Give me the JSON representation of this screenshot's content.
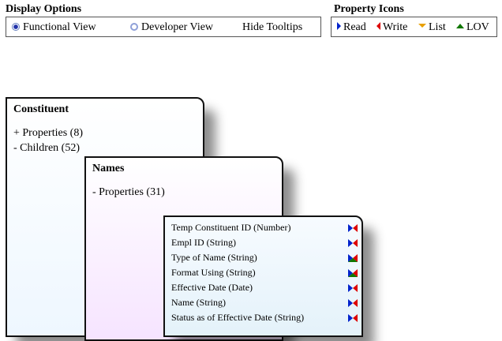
{
  "display_options": {
    "title": "Display Options",
    "functional_view": "Functional View",
    "developer_view": "Developer View",
    "hide_tooltips": "Hide Tooltips",
    "selected": "Functional View"
  },
  "property_icons": {
    "title": "Property Icons",
    "read": "Read",
    "write": "Write",
    "list": "List",
    "lov": "LOV",
    "colors": {
      "read": "#0022cc",
      "write": "#dd0000",
      "list": "#e8a000",
      "lov": "#117700"
    }
  },
  "cards": {
    "constituent": {
      "title": "Constituent",
      "properties": "+ Properties (8)",
      "children": "- Children (52)"
    },
    "names": {
      "title": "Names",
      "properties": "- Properties (31)"
    }
  },
  "properties": [
    {
      "label": "Temp Constituent ID (Number)",
      "icons": [
        "read-icon",
        "write-icon"
      ]
    },
    {
      "label": "Empl ID (String)",
      "icons": [
        "read-icon",
        "write-icon"
      ]
    },
    {
      "label": "Type of Name (String)",
      "icons": [
        "read-icon",
        "write-icon",
        "lov-icon"
      ]
    },
    {
      "label": "Format Using (String)",
      "icons": [
        "read-icon",
        "write-icon",
        "lov-icon"
      ]
    },
    {
      "label": "Effective Date (Date)",
      "icons": [
        "read-icon",
        "write-icon"
      ]
    },
    {
      "label": "Name (String)",
      "icons": [
        "read-icon",
        "write-icon"
      ]
    },
    {
      "label": "Status as of Effective Date (String)",
      "icons": [
        "read-icon",
        "write-icon"
      ]
    }
  ]
}
